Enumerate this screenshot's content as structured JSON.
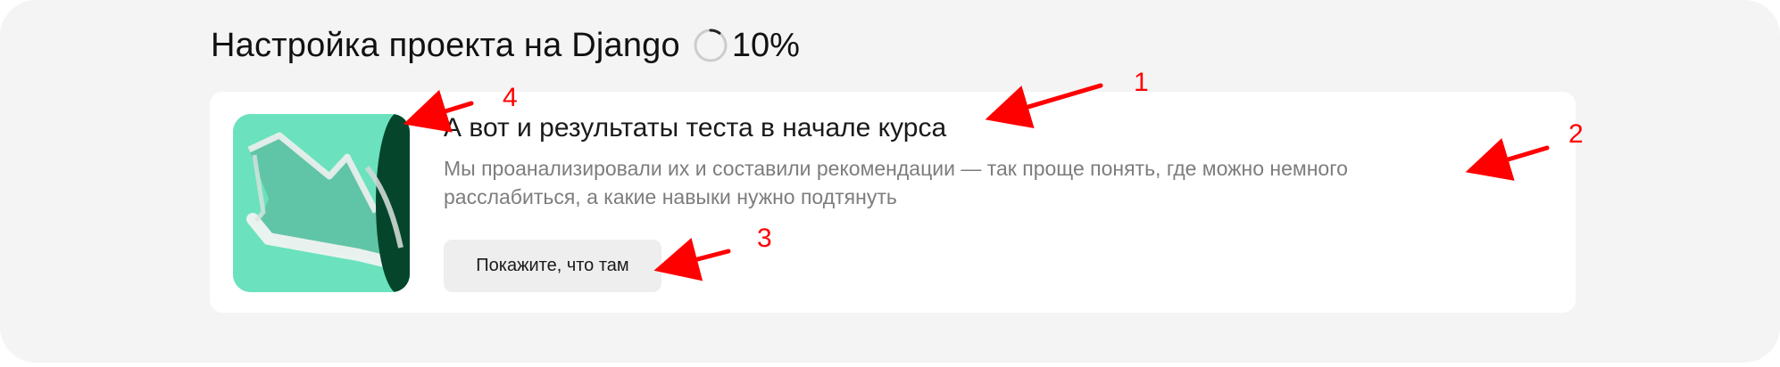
{
  "header": {
    "title": "Настройка проекта на Django",
    "progress_label": "10%",
    "progress_fraction": 0.1
  },
  "card": {
    "title": "А вот и результаты теста в начале курса",
    "description": "Мы проанализировали их и составили рекомендации — так проще понять, где можно немного расслабиться, а какие навыки нужно подтянуть",
    "button_label": "Покажите, что там",
    "image_icon": "arrow-pointer-illustration"
  },
  "annotations": {
    "color": "#ff0000",
    "labels": [
      "1",
      "2",
      "3",
      "4"
    ]
  },
  "colors": {
    "page_background": "#f4f4f4",
    "card_background": "#ffffff",
    "illustration_green": "#6be2bd",
    "illustration_dark": "#04452c",
    "button_background": "#eeeeee",
    "description_text": "#7d7d7d"
  }
}
